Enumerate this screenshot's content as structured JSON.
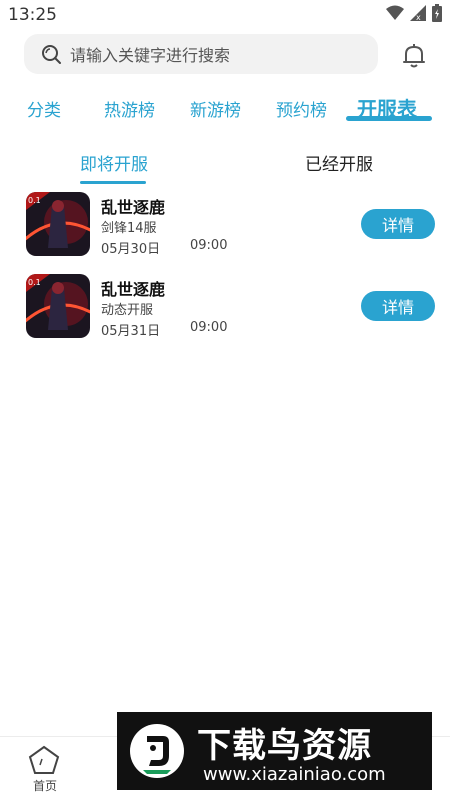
{
  "status": {
    "time": "13:25"
  },
  "search": {
    "placeholder": "请输入关键字进行搜索"
  },
  "tabs": [
    {
      "label": "分类"
    },
    {
      "label": "热游榜"
    },
    {
      "label": "新游榜"
    },
    {
      "label": "预约榜"
    },
    {
      "label": "开服表"
    }
  ],
  "subtabs": [
    {
      "label": "即将开服"
    },
    {
      "label": "已经开服"
    }
  ],
  "servers": [
    {
      "name": "乱世逐鹿",
      "server": "剑锋14服",
      "date": "05月30日",
      "time": "09:00",
      "button": "详情"
    },
    {
      "name": "乱世逐鹿",
      "server": "动态开服",
      "date": "05月31日",
      "time": "09:00",
      "button": "详情"
    }
  ],
  "bottom_nav": {
    "home_label": "首页"
  },
  "watermark": {
    "title": "下载鸟资源",
    "url": "www.xiazainiao.com"
  },
  "colors": {
    "accent": "#2aa3d0"
  }
}
